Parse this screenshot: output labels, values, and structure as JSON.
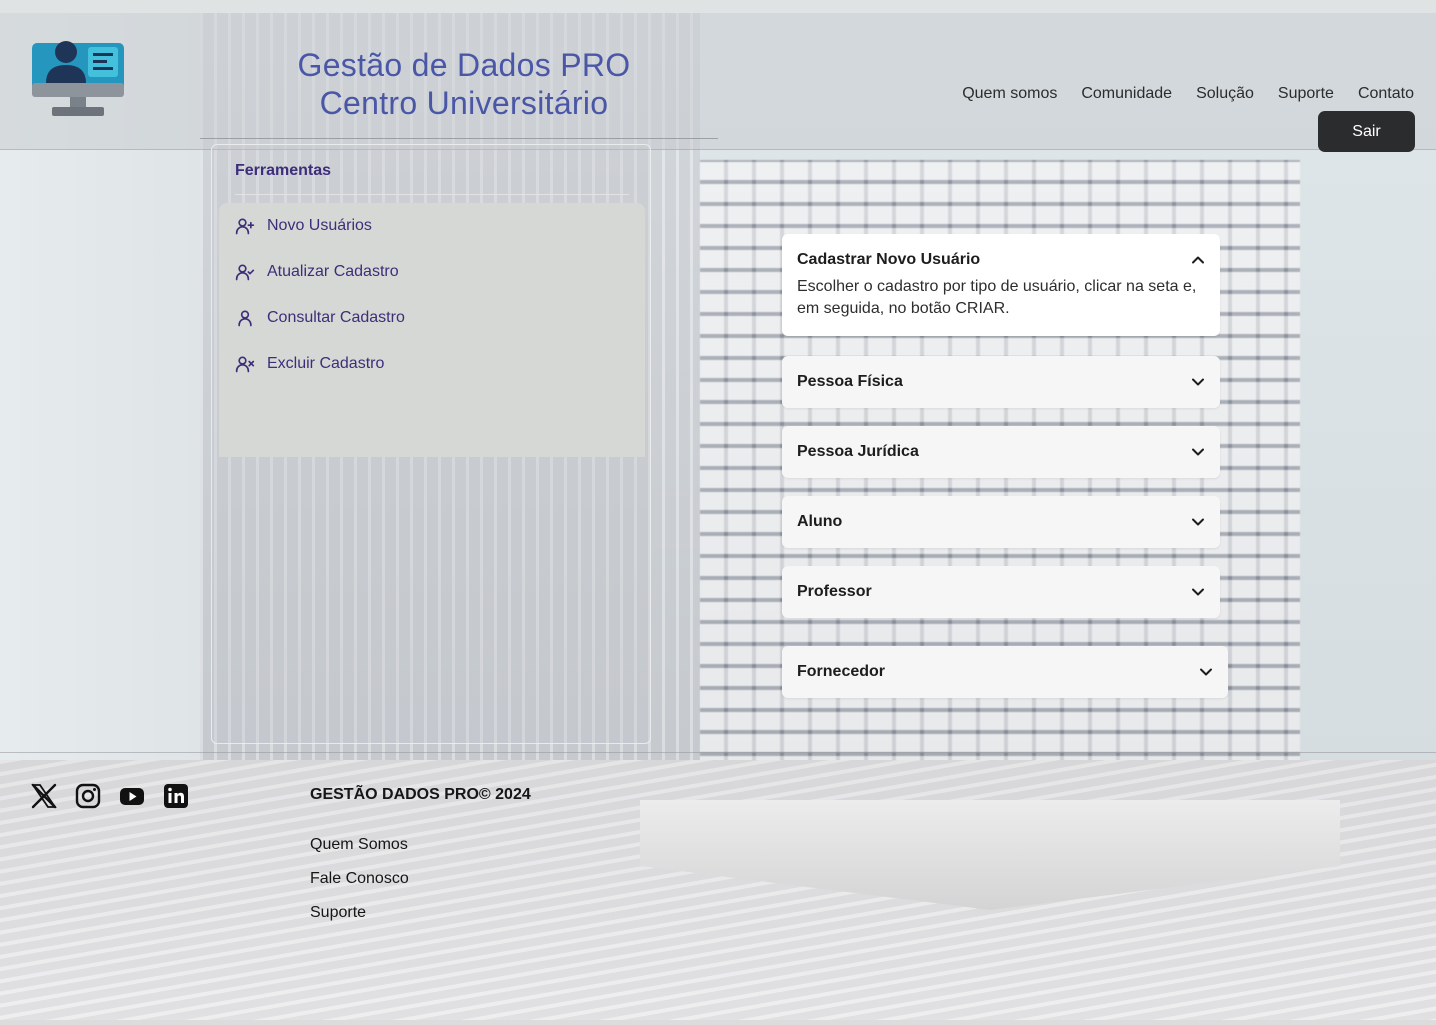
{
  "header": {
    "title_line1": "Gestão de Dados PRO",
    "title_line2": "Centro Universitário",
    "nav": [
      "Quem somos",
      "Comunidade",
      "Solução",
      "Suporte",
      "Contato"
    ],
    "logout_label": "Sair"
  },
  "tools": {
    "title": "Ferramentas",
    "items": [
      {
        "label": "Novo Usuários",
        "icon": "user-plus-icon"
      },
      {
        "label": "Atualizar Cadastro",
        "icon": "user-check-icon"
      },
      {
        "label": "Consultar Cadastro",
        "icon": "user-icon"
      },
      {
        "label": "Excluir Cadastro",
        "icon": "user-x-icon"
      }
    ]
  },
  "accordion": {
    "open_section": {
      "title": "Cadastrar Novo Usuário",
      "body": "Escolher o cadastro por tipo de usuário, clicar na seta e, em seguida, no botão CRIAR."
    },
    "sections": [
      "Pessoa Física",
      "Pessoa Jurídica",
      "Aluno",
      "Professor",
      "Fornecedor"
    ]
  },
  "footer": {
    "brand": "GESTÃO DADOS PRO© 2024",
    "links": [
      "Quem Somos",
      "Fale Conosco",
      "Suporte"
    ],
    "social": [
      "x-icon",
      "instagram-icon",
      "youtube-icon",
      "linkedin-icon"
    ]
  },
  "colors": {
    "brand_blue": "#4a57a6",
    "tool_purple": "#3e2e7a",
    "button_dark": "#2b2c2e"
  }
}
